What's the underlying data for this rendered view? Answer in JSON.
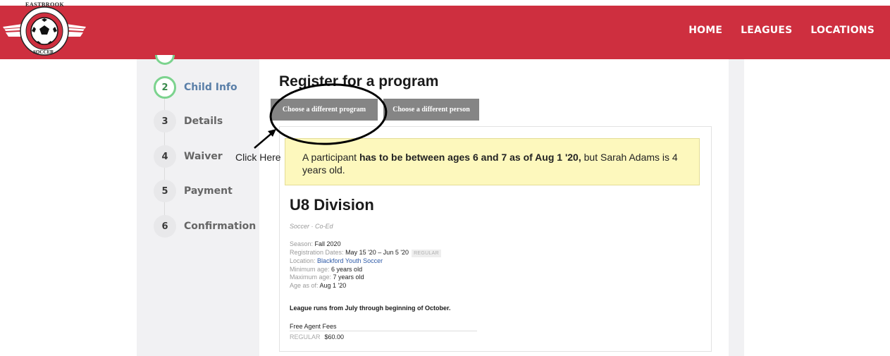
{
  "header": {
    "logo_top_text": "EASTBROOK",
    "logo_bottom_text": "SOCCER",
    "nav": [
      "HOME",
      "LEAGUES",
      "LOCATIONS"
    ]
  },
  "steps": [
    {
      "num": "2",
      "label": "Child Info",
      "active": true
    },
    {
      "num": "3",
      "label": "Details"
    },
    {
      "num": "4",
      "label": "Waiver"
    },
    {
      "num": "5",
      "label": "Payment"
    },
    {
      "num": "6",
      "label": "Confirmation"
    }
  ],
  "main": {
    "title": "Register for a program",
    "btn_program": "Choose a different program",
    "btn_person": "Choose a different person"
  },
  "warning": {
    "pre": "A participant ",
    "bold": "has to be between ages 6 and 7 as of Aug 1 '20,",
    "post": " but Sarah Adams is 4 years old."
  },
  "program": {
    "division": "U8 Division",
    "sport": "Soccer · Co-Ed",
    "season_k": "Season:",
    "season_v": "Fall 2020",
    "reg_k": "Registration Dates:",
    "reg_v": "May 15 '20 – Jun 5 '20",
    "reg_badge": "REGULAR",
    "loc_k": "Location:",
    "loc_v": "Blackford Youth Soccer",
    "min_k": "Minimum age:",
    "min_v": "6 years old",
    "max_k": "Maximum age:",
    "max_v": "7 years old",
    "asof_k": "Age as of:",
    "asof_v": "Aug 1 '20",
    "league_note": "League runs from July through beginning of October.",
    "fees_title": "Free Agent Fees",
    "fee_k": "REGULAR",
    "fee_v": "$60.00"
  },
  "annotation": {
    "text": "Click Here"
  },
  "colors": {
    "header": "#ce2f3f",
    "step_active": "#7cd38e",
    "warning_bg": "#fdf8bd",
    "button": "#858585"
  }
}
